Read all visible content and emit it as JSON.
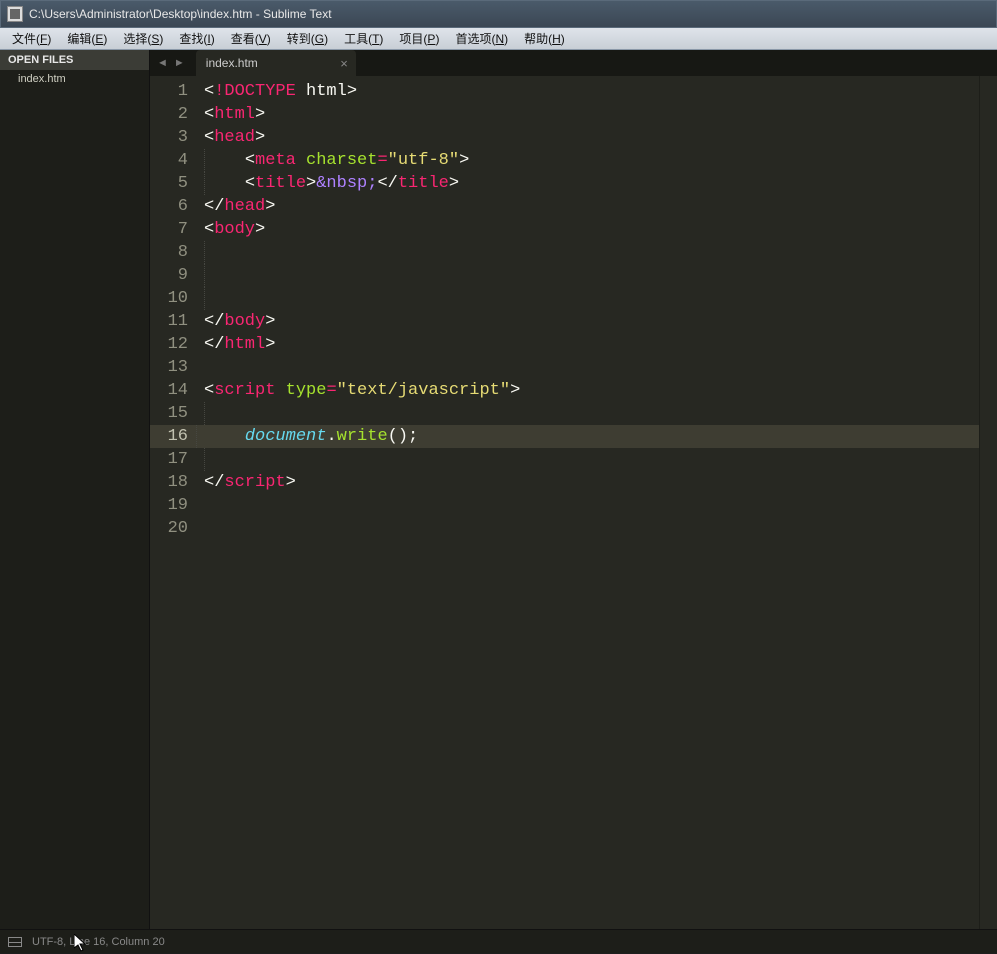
{
  "window": {
    "title": "C:\\Users\\Administrator\\Desktop\\index.htm - Sublime Text"
  },
  "menu": [
    {
      "label": "文件",
      "key": "F"
    },
    {
      "label": "编辑",
      "key": "E"
    },
    {
      "label": "选择",
      "key": "S"
    },
    {
      "label": "查找",
      "key": "I"
    },
    {
      "label": "查看",
      "key": "V"
    },
    {
      "label": "转到",
      "key": "G"
    },
    {
      "label": "工具",
      "key": "T"
    },
    {
      "label": "项目",
      "key": "P"
    },
    {
      "label": "首选项",
      "key": "N"
    },
    {
      "label": "帮助",
      "key": "H"
    }
  ],
  "sidebar": {
    "header": "OPEN FILES",
    "files": [
      "index.htm"
    ]
  },
  "tabs": {
    "prev": "◄",
    "next": "►",
    "items": [
      {
        "label": "index.htm",
        "close": "×"
      }
    ]
  },
  "editor": {
    "active_line": 16,
    "line_count": 20,
    "code_tokens": [
      [
        [
          "<",
          "c-angle"
        ],
        [
          "!DOCTYPE",
          "c-doctype"
        ],
        [
          " ",
          "c-text"
        ],
        [
          "html",
          "c-doctype-name"
        ],
        [
          ">",
          "c-angle"
        ]
      ],
      [
        [
          "<",
          "c-angle"
        ],
        [
          "html",
          "c-tag"
        ],
        [
          ">",
          "c-angle"
        ]
      ],
      [
        [
          "<",
          "c-angle"
        ],
        [
          "head",
          "c-tag"
        ],
        [
          ">",
          "c-angle"
        ]
      ],
      [
        [
          "    ",
          "c-text"
        ],
        [
          "<",
          "c-angle"
        ],
        [
          "meta",
          "c-tag"
        ],
        [
          " ",
          "c-text"
        ],
        [
          "charset",
          "c-attr"
        ],
        [
          "=",
          "c-op"
        ],
        [
          "\"utf-8\"",
          "c-str"
        ],
        [
          ">",
          "c-angle"
        ]
      ],
      [
        [
          "    ",
          "c-text"
        ],
        [
          "<",
          "c-angle"
        ],
        [
          "title",
          "c-tag"
        ],
        [
          ">",
          "c-angle"
        ],
        [
          "&nbsp;",
          "c-entity"
        ],
        [
          "</",
          "c-angle"
        ],
        [
          "title",
          "c-tag"
        ],
        [
          ">",
          "c-angle"
        ]
      ],
      [
        [
          "</",
          "c-angle"
        ],
        [
          "head",
          "c-tag"
        ],
        [
          ">",
          "c-angle"
        ]
      ],
      [
        [
          "<",
          "c-angle"
        ],
        [
          "body",
          "c-tag"
        ],
        [
          ">",
          "c-angle"
        ]
      ],
      [],
      [],
      [],
      [
        [
          "</",
          "c-angle"
        ],
        [
          "body",
          "c-tag"
        ],
        [
          ">",
          "c-angle"
        ]
      ],
      [
        [
          "</",
          "c-angle"
        ],
        [
          "html",
          "c-tag"
        ],
        [
          ">",
          "c-angle"
        ]
      ],
      [],
      [
        [
          "<",
          "c-angle"
        ],
        [
          "script",
          "c-tag"
        ],
        [
          " ",
          "c-text"
        ],
        [
          "type",
          "c-attr"
        ],
        [
          "=",
          "c-op"
        ],
        [
          "\"text/javascript\"",
          "c-str"
        ],
        [
          ">",
          "c-angle"
        ]
      ],
      [],
      [
        [
          "    ",
          "c-text"
        ],
        [
          "document",
          "c-ident"
        ],
        [
          ".",
          "c-text"
        ],
        [
          "write",
          "c-func"
        ],
        [
          "();",
          "c-text"
        ]
      ],
      [],
      [
        [
          "</",
          "c-angle"
        ],
        [
          "script",
          "c-tag"
        ],
        [
          ">",
          "c-angle"
        ]
      ],
      [],
      []
    ]
  },
  "status": {
    "encoding": "UTF-8",
    "position": "Line 16, Column 20"
  }
}
